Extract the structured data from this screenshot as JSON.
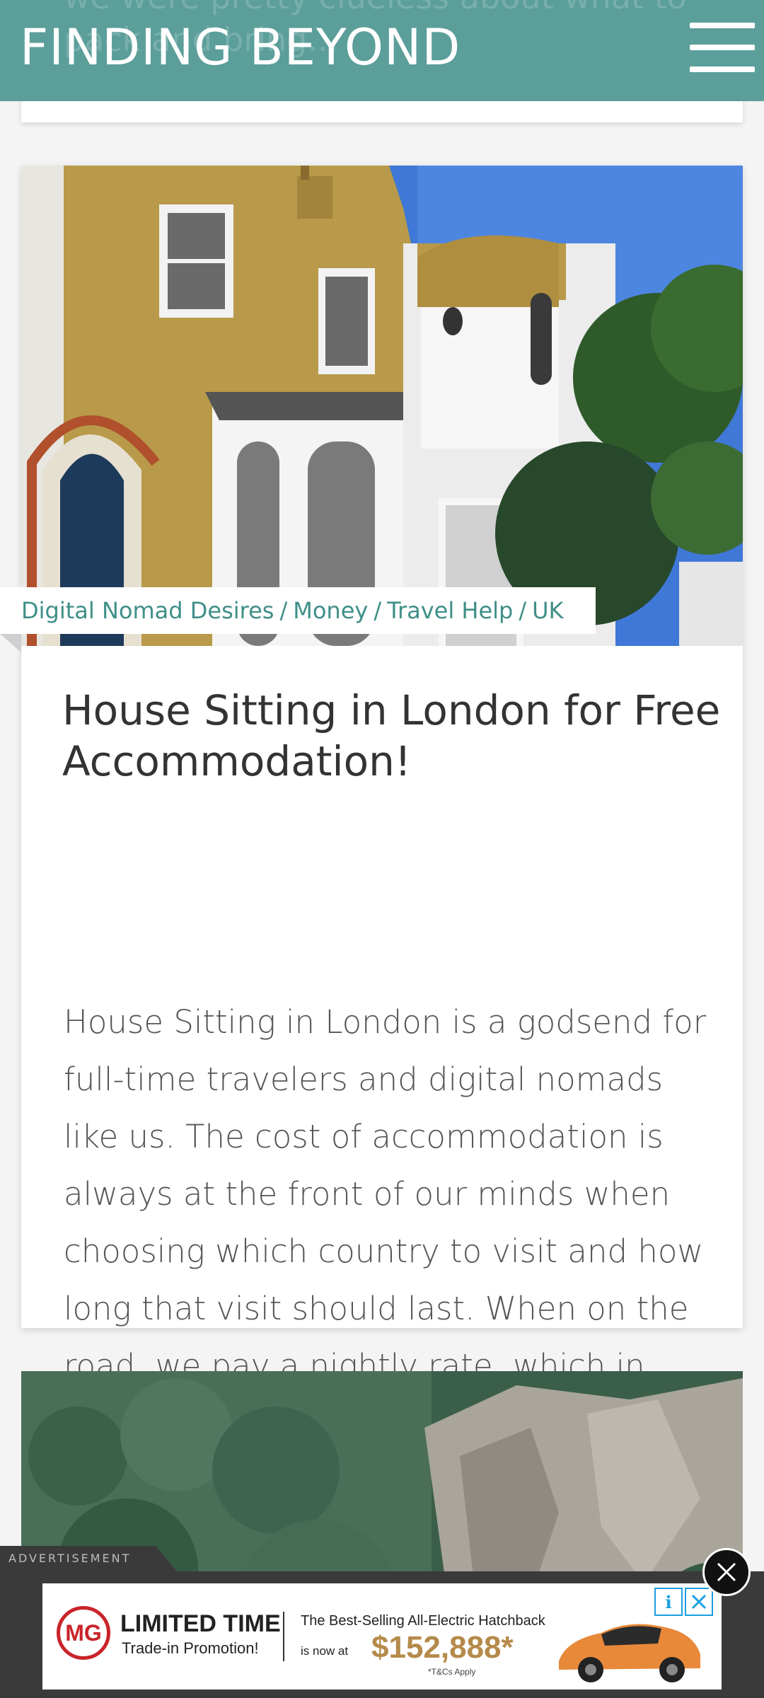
{
  "header": {
    "site_title": "FINDING BEYOND",
    "ghost_text": "we were pretty clueless about what to pack and bring..."
  },
  "article": {
    "categories": [
      "Digital Nomad Desires",
      "Money",
      "Travel Help",
      "UK"
    ],
    "category_separator": "/",
    "title": "House Sitting in London for Free Accommodation!",
    "excerpt": "House Sitting in London is a godsend for full-time travelers and digital nomads like us. The cost of accommodation is always at the front of our minds when choosing which country to visit and how long that visit should last. When on the road, we pay a nightly rate, which in some countries can amount..."
  },
  "ad": {
    "label": "ADVERTISEMENT",
    "brand_logo": "MG",
    "headline": "LIMITED TIME",
    "subline": "Trade-in Promotion!",
    "best_selling": "The Best-Selling All-Electric Hatchback",
    "now_at": "is now at",
    "price": "$152,888*",
    "terms": "*T&Cs Apply",
    "info_icon": "i"
  },
  "colors": {
    "header_bg": "#5b9e9a",
    "category_text": "#3f8f88",
    "mg_red": "#c9242a",
    "price_gold": "#b58a4a"
  }
}
